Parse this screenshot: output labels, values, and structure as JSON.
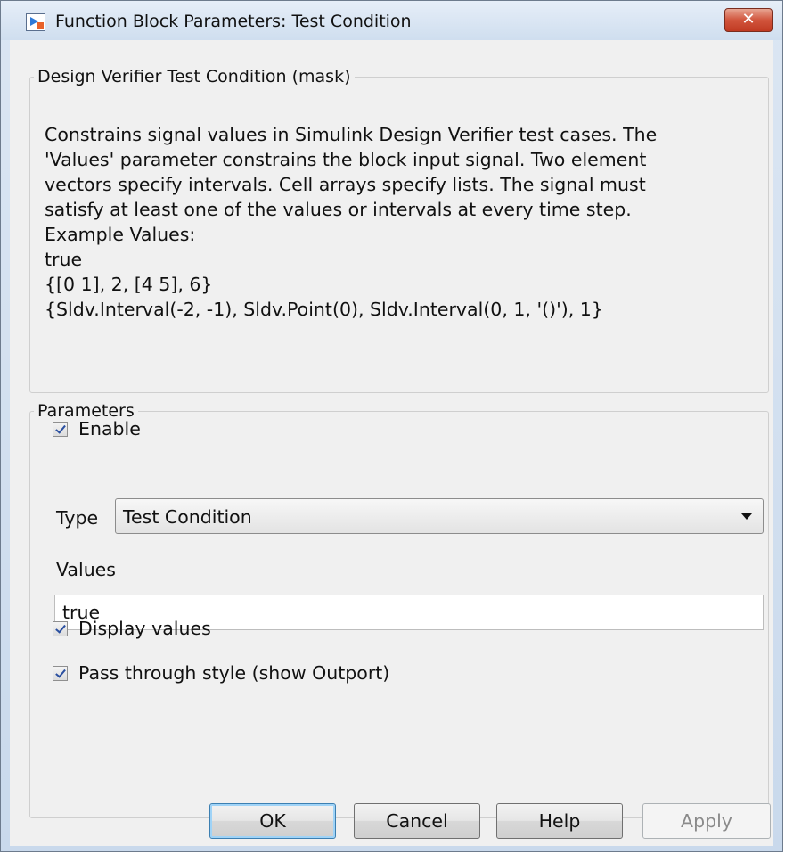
{
  "window": {
    "title": "Function Block Parameters: Test Condition",
    "close_glyph": "✕"
  },
  "description": {
    "legend": "Design Verifier Test Condition (mask)",
    "lines": [
      "Constrains signal values in Simulink Design Verifier test cases. The",
      "'Values' parameter constrains the block input signal.  Two element",
      "vectors specify intervals.  Cell arrays specify lists.  The signal must",
      "satisfy at least one of the values or intervals at every time step.",
      "Example Values:",
      "true",
      "{[0 1], 2, [4 5], 6}",
      "{Sldv.Interval(-2, -1), Sldv.Point(0), Sldv.Interval(0, 1, '()'), 1}"
    ]
  },
  "parameters": {
    "legend": "Parameters",
    "enable": {
      "label": "Enable",
      "checked": true
    },
    "type": {
      "label": "Type",
      "value": "Test Condition"
    },
    "values": {
      "label": "Values",
      "value": "true"
    },
    "display_values": {
      "label": "Display values",
      "checked": true
    },
    "pass_through": {
      "label": "Pass through style (show Outport)",
      "checked": true
    }
  },
  "buttons": {
    "ok": "OK",
    "cancel": "Cancel",
    "help": "Help",
    "apply": "Apply"
  }
}
